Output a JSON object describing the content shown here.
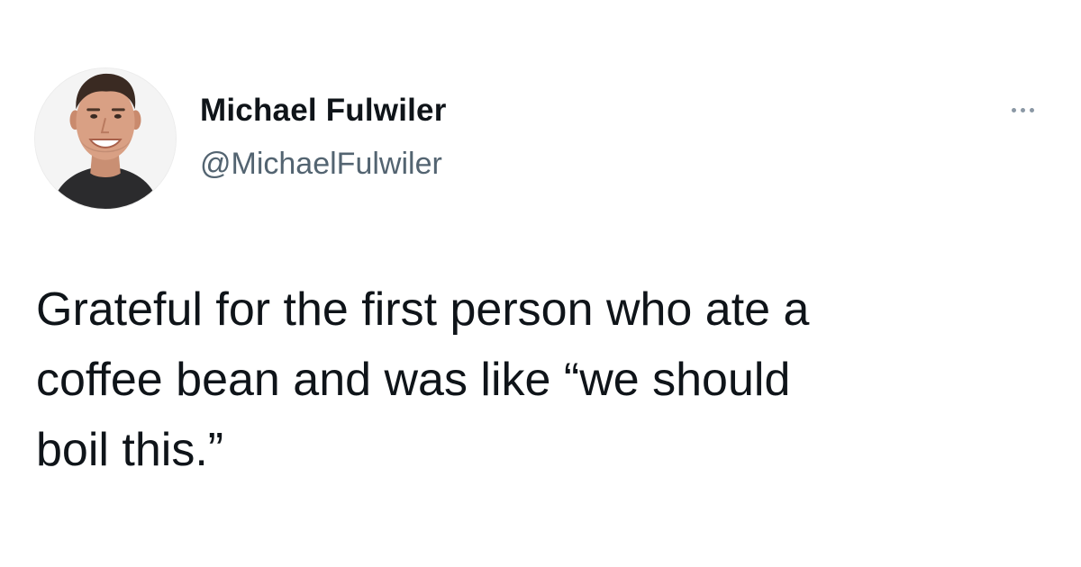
{
  "author": {
    "display_name": "Michael Fulwiler",
    "handle": "@MichaelFulwiler",
    "avatar_icon": "profile-photo"
  },
  "menu": {
    "icon": "more-horizontal-icon"
  },
  "tweet": {
    "lines": [
      "Grateful for the first person who ate a",
      "coffee bean and was like “we should",
      "boil this.”"
    ]
  },
  "colors": {
    "text": "#0f1419",
    "secondary_text": "#536471",
    "background": "#ffffff"
  }
}
